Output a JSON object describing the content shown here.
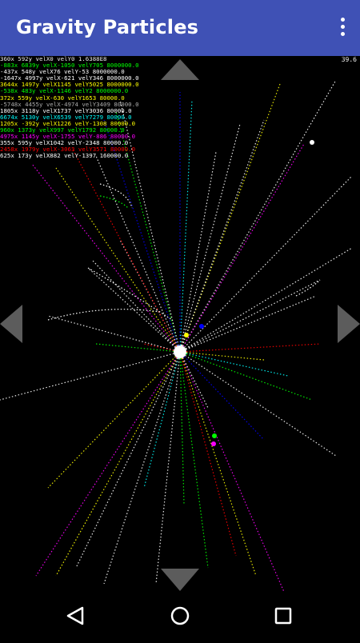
{
  "app": {
    "title": "Gravity Particles"
  },
  "overflow_menu": {
    "icon": "overflow-menu-icon"
  },
  "fps": "39.6",
  "debug_lines": [
    {
      "text": "360x 592y velX0 velY0 1.6388E8",
      "color": "#ffffff"
    },
    {
      "text": "-883x 6839y velX-1050 velY705 8000000.0",
      "color": "#00ff00"
    },
    {
      "text": "-437x 548y velX76 velY-53 8000000.0",
      "color": "#ffffff"
    },
    {
      "text": "-1647x 4997y velX-621 velY346 8000000.0",
      "color": "#ffffff"
    },
    {
      "text": "3644x 1497y velX1145 velY5025 8000000.0",
      "color": "#ffff00"
    },
    {
      "text": "-538x 483y velX-1146 velY2 8000000.0",
      "color": "#00ff00"
    },
    {
      "text": "372x 559y velX-630 velY1653 80000.0",
      "color": "#ffff00"
    },
    {
      "text": "-5748x 4455y velX-4974 velY3409 80000.0",
      "color": "#aaaaaa"
    },
    {
      "text": "1805x 3118y velX1737 velY3036 80000.0",
      "color": "#ffffff"
    },
    {
      "text": "6674x 5130y velX6539 velY7279 80000.0",
      "color": "#00ffff"
    },
    {
      "text": "1205x -392y velX1226 velY-1308 80000.0",
      "color": "#ffff00"
    },
    {
      "text": "960x 1373y velX997 velY1792 80000.0",
      "color": "#00ff00"
    },
    {
      "text": "4975x 1145y velX-1755 velY-886 80000.0",
      "color": "#ff00ff"
    },
    {
      "text": "355x 595y velX1042 velY-2348 80000.0",
      "color": "#ffffff"
    },
    {
      "text": "2458x 1979y velX-3063 velY3571 80000.0",
      "color": "#ff0000"
    },
    {
      "text": "625x 173y velX882 velY-1397 160000.0",
      "color": "#ffffff"
    }
  ],
  "controls": {
    "up": "arrow-up-icon",
    "down": "arrow-down-icon",
    "left": "arrow-left-icon",
    "right": "arrow-right-icon"
  },
  "navbar": {
    "back": "back-icon",
    "home": "home-icon",
    "recents": "recents-icon"
  }
}
